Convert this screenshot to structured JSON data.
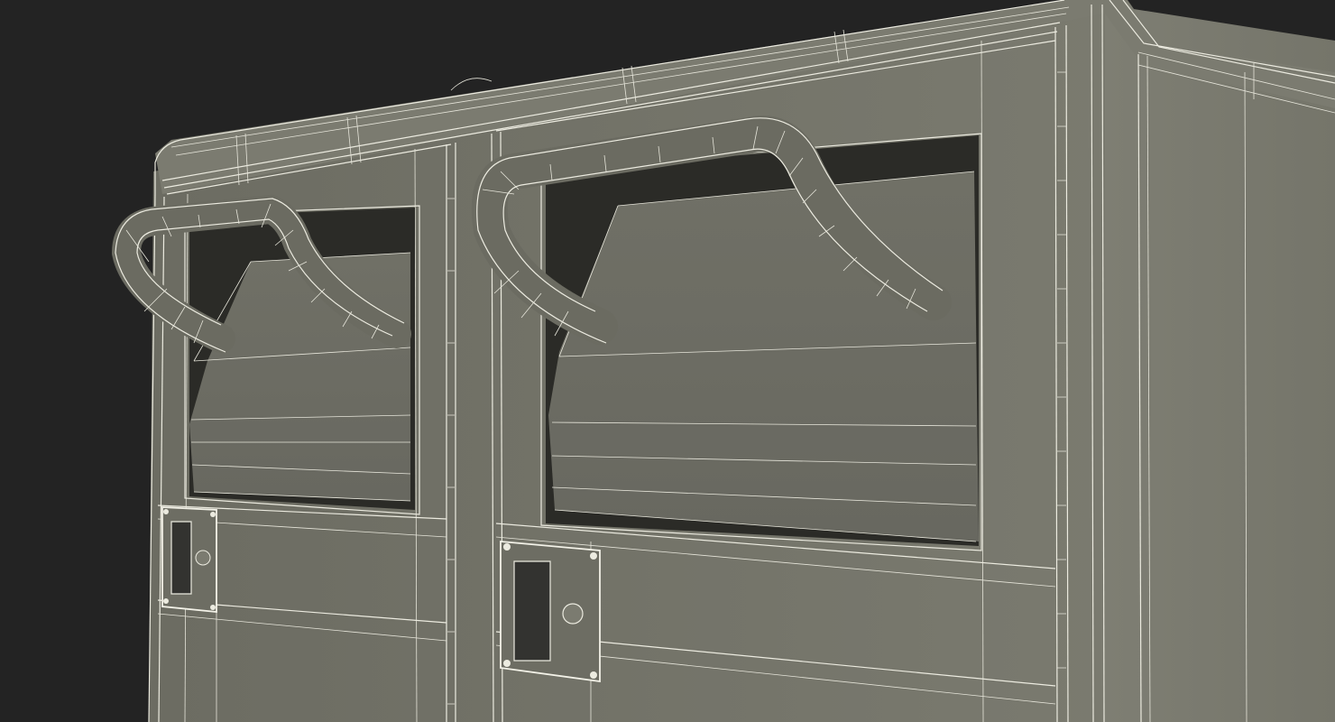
{
  "scene": {
    "subject": "wireframe-3d-render",
    "colors": {
      "background": "#232323",
      "body": "#727267",
      "body_light": "#7d7d72",
      "body_dark": "#5f5f56",
      "opening": "#2b2b27",
      "wire": "#ecebe0"
    }
  }
}
